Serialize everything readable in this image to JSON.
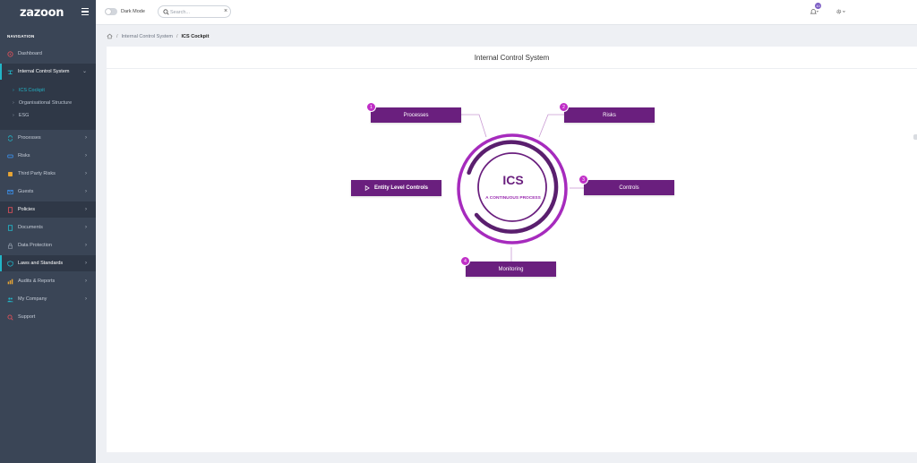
{
  "app": {
    "logo": "zazoon"
  },
  "sidebar": {
    "heading": "NAVIGATION",
    "items": [
      {
        "label": "Dashboard",
        "icon": "dashboard-icon"
      },
      {
        "label": "Internal Control System",
        "icon": "control-system-icon",
        "expanded": true
      },
      {
        "label": "Processes",
        "icon": "processes-icon"
      },
      {
        "label": "Risks",
        "icon": "risks-icon"
      },
      {
        "label": "Third Party Risks",
        "icon": "third-party-icon"
      },
      {
        "label": "Guests",
        "icon": "guests-icon"
      },
      {
        "label": "Policies",
        "icon": "policies-icon"
      },
      {
        "label": "Documents",
        "icon": "documents-icon"
      },
      {
        "label": "Data Protection",
        "icon": "lock-icon"
      },
      {
        "label": "Laws and Standards",
        "icon": "shield-icon"
      },
      {
        "label": "Audits & Reports",
        "icon": "audits-icon"
      },
      {
        "label": "My Company",
        "icon": "company-icon"
      },
      {
        "label": "Support",
        "icon": "support-icon"
      }
    ],
    "subitems": [
      {
        "label": "ICS Cockpit",
        "current": true
      },
      {
        "label": "Organisational Structure"
      },
      {
        "label": "ESG"
      }
    ]
  },
  "topbar": {
    "dark_mode_label": "Dark Mode",
    "search_placeholder": "Search...",
    "search_clear": "×",
    "notification_count": "10"
  },
  "breadcrumb": {
    "parent": "Internal Control System",
    "current": "ICS Cockpit"
  },
  "page": {
    "title": "Internal Control System"
  },
  "diagram": {
    "center_title": "ICS",
    "center_subtitle": "A CONTINUOUS PROCESS",
    "steps": [
      {
        "num": "1",
        "label": "Processes"
      },
      {
        "num": "2",
        "label": "Risks"
      },
      {
        "num": "3",
        "label": "Controls"
      },
      {
        "num": "4",
        "label": "Monitoring"
      }
    ],
    "entity_label": "Entity Level Controls",
    "colors": {
      "primary": "#6a1f7e",
      "accent": "#c02ec7",
      "ring": "#9a2bb0"
    }
  }
}
